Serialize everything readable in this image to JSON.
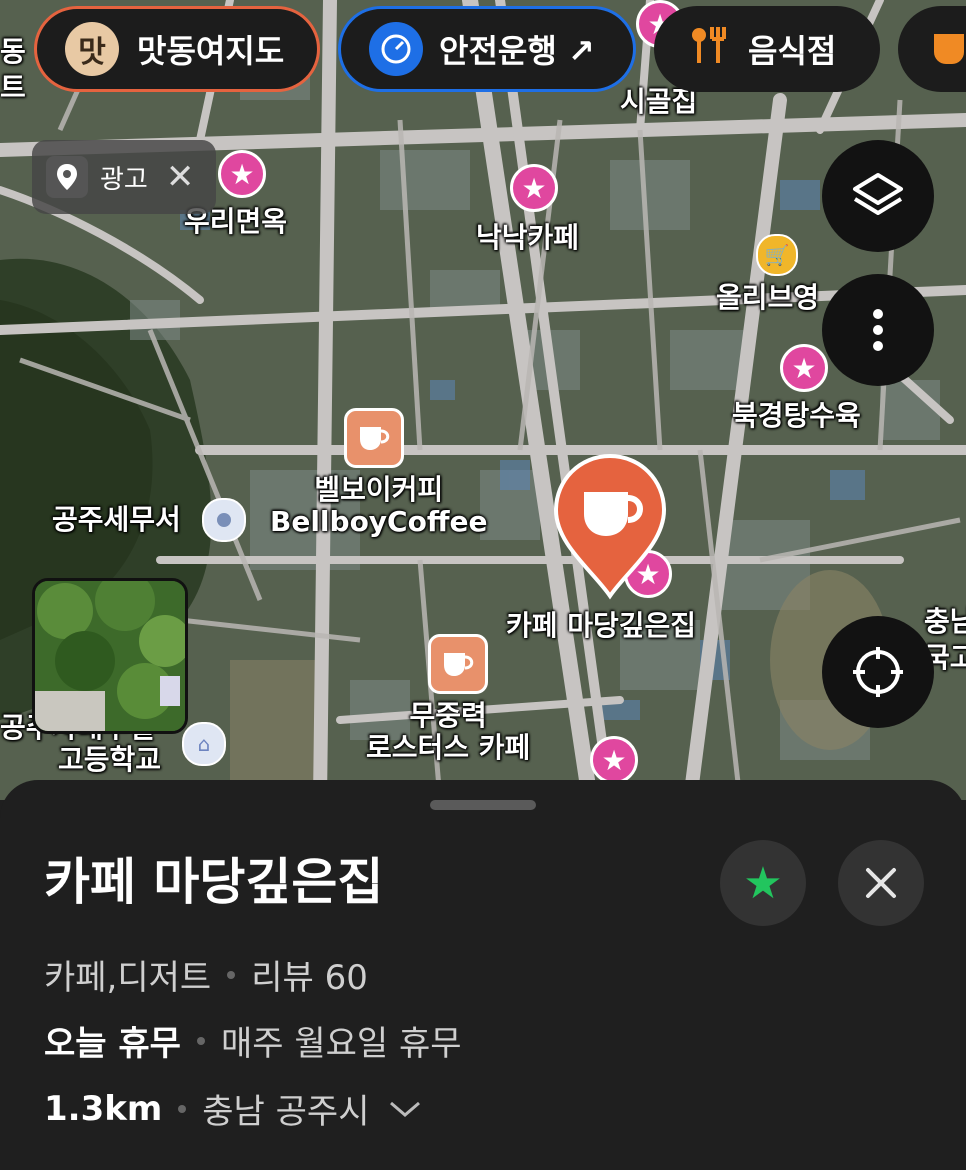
{
  "chips": {
    "food_map": "맛동여지도",
    "food_map_icon_text": "맛",
    "safe_drive": "안전운행 ↗",
    "restaurant": "음식점"
  },
  "ad": {
    "label": "광고"
  },
  "map_labels": {
    "edge_left_1": "동",
    "edge_left_2": "트",
    "sigolzip": "시골집",
    "uri_myeonok": "우리면옥",
    "nakrak_cafe": "낙낙카페",
    "olive_young": "올리브영",
    "bukgyeong": "북경탕수육",
    "bellboy_ko": "벨보이커피",
    "bellboy_en": "BellboyCoffee",
    "tax_office": "공주세무서",
    "cafe_madang": "카페 마당깊은집",
    "mujungryeok_1": "무중력",
    "mujungryeok_2": "로스터스 카페",
    "school_1": "공주사대부설",
    "school_2": "고등학교",
    "edge_right_1": "충남",
    "edge_right_2": "국고"
  },
  "place": {
    "name": "카페 마당깊은집",
    "category": "카페,디저트",
    "reviews": "리뷰 60",
    "status": "오늘 휴무",
    "hours": "매주 월요일 휴무",
    "distance": "1.3km",
    "region": "충남 공주시"
  },
  "colors": {
    "accent_orange": "#e5633f",
    "pin_pink": "#e0479f",
    "safe_blue": "#1e6fe6",
    "fav_green": "#22c55e"
  }
}
